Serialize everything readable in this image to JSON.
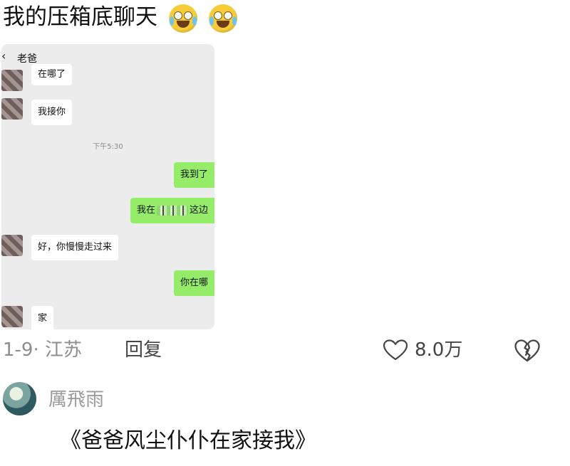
{
  "post": {
    "title": "我的压箱底聊天",
    "emojis": [
      "crying-laughing-emoji",
      "crying-laughing-emoji"
    ]
  },
  "chat_screenshot": {
    "back_glyph": "‹",
    "contact": "老爸",
    "messages": [
      {
        "side": "left",
        "text": "在哪了"
      },
      {
        "side": "left",
        "text": "我接你"
      },
      {
        "timestamp": "下午5:30"
      },
      {
        "side": "right",
        "text": "我到了"
      },
      {
        "side": "right",
        "text_before": "我在",
        "text_after": "这边"
      },
      {
        "side": "left",
        "text": "好，你慢慢走过来"
      },
      {
        "side": "right",
        "text": "你在哪"
      },
      {
        "side": "left",
        "text": "家"
      }
    ]
  },
  "post_meta": {
    "date_location": "1-9· 江苏",
    "reply_label": "回复",
    "like_count": "8.0万",
    "like_icon": "heart-outline-icon",
    "dislike_icon": "broken-heart-icon"
  },
  "reply": {
    "username": "厲飛雨",
    "text": "《爸爸风尘仆仆在家接我》"
  },
  "colors": {
    "bubble_right": "#95ec69",
    "bubble_left": "#ffffff",
    "chat_bg": "#ececec",
    "meta_gray": "#8d8d8d"
  }
}
